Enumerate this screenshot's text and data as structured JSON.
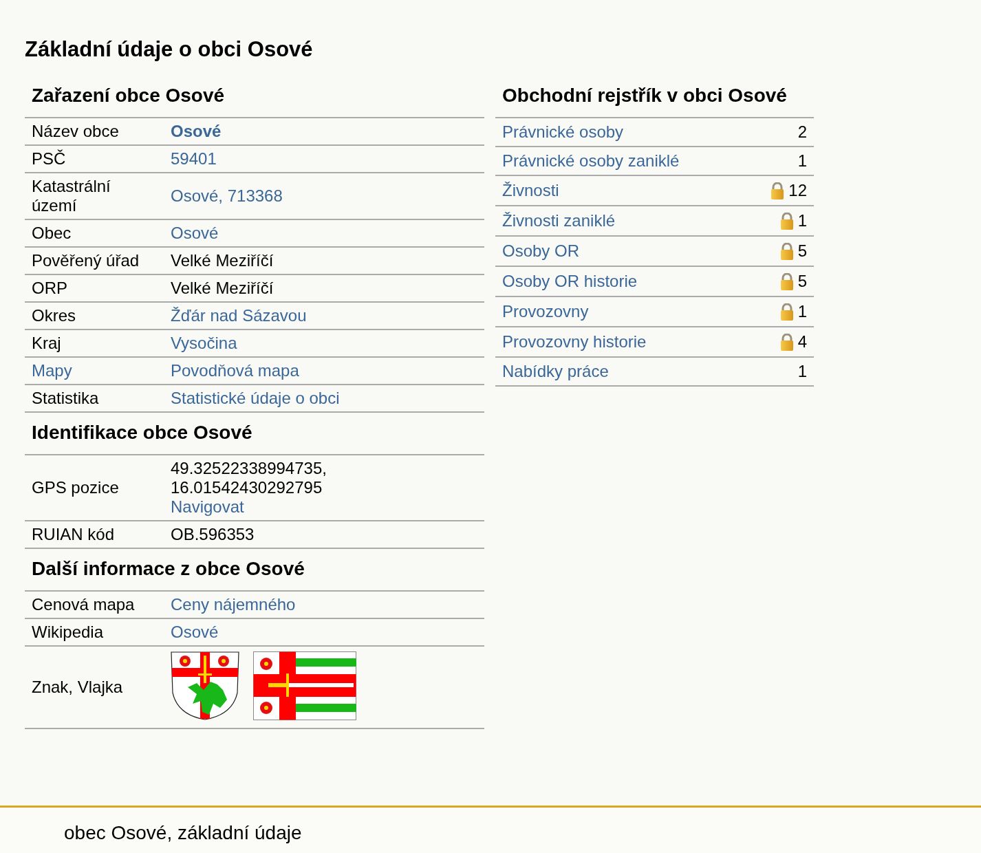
{
  "page_title": "Základní údaje o obci Osové",
  "sections": [
    {
      "title": "Zařazení obce Osové",
      "rows": [
        {
          "label": {
            "text": "Název obce",
            "kind": "text"
          },
          "value": [
            {
              "text": "Osové",
              "kind": "strong_link"
            }
          ]
        },
        {
          "label": {
            "text": "PSČ",
            "kind": "text"
          },
          "value": [
            {
              "text": "59401",
              "kind": "link"
            }
          ]
        },
        {
          "label": {
            "text": "Katastrální území",
            "kind": "text"
          },
          "value": [
            {
              "text": "Osové, 713368",
              "kind": "link"
            }
          ]
        },
        {
          "label": {
            "text": "Obec",
            "kind": "text"
          },
          "value": [
            {
              "text": "Osové",
              "kind": "link"
            }
          ]
        },
        {
          "label": {
            "text": "Pověřený úřad",
            "kind": "text"
          },
          "value": [
            {
              "text": "Velké Meziříčí",
              "kind": "text"
            }
          ]
        },
        {
          "label": {
            "text": "ORP",
            "kind": "text"
          },
          "value": [
            {
              "text": "Velké Meziříčí",
              "kind": "text"
            }
          ]
        },
        {
          "label": {
            "text": "Okres",
            "kind": "text"
          },
          "value": [
            {
              "text": "Žďár nad Sázavou",
              "kind": "link"
            }
          ]
        },
        {
          "label": {
            "text": "Kraj",
            "kind": "text"
          },
          "value": [
            {
              "text": "Vysočina",
              "kind": "link"
            }
          ]
        },
        {
          "label": {
            "text": "Mapy",
            "kind": "link"
          },
          "value": [
            {
              "text": "Povodňová mapa",
              "kind": "link"
            }
          ]
        },
        {
          "label": {
            "text": "Statistika",
            "kind": "text"
          },
          "value": [
            {
              "text": "Statistické údaje o obci",
              "kind": "link"
            }
          ]
        }
      ]
    },
    {
      "title": "Identifikace obce Osové",
      "rows": [
        {
          "label": {
            "text": "GPS pozice",
            "kind": "text"
          },
          "value": [
            {
              "text": "49.32522338994735,",
              "kind": "text"
            },
            {
              "text": "16.01542430292795",
              "kind": "text"
            },
            {
              "text": "Navigovat",
              "kind": "link"
            }
          ]
        },
        {
          "label": {
            "text": "RUIAN kód",
            "kind": "text"
          },
          "value": [
            {
              "text": "OB.596353",
              "kind": "text"
            }
          ]
        }
      ]
    },
    {
      "title": "Další informace z obce Osové",
      "rows": [
        {
          "label": {
            "text": "Cenová mapa",
            "kind": "text"
          },
          "value": [
            {
              "text": "Ceny nájemného",
              "kind": "link"
            }
          ]
        },
        {
          "label": {
            "text": "Wikipedia",
            "kind": "text"
          },
          "value": [
            {
              "text": "Osové",
              "kind": "link"
            }
          ]
        },
        {
          "label": {
            "text": "Znak, Vlajka",
            "kind": "text"
          },
          "value": [
            {
              "kind": "coat_of_arms"
            },
            {
              "kind": "flag"
            }
          ]
        }
      ]
    }
  ],
  "register": {
    "title": "Obchodní rejstřík v obci Osové",
    "rows": [
      {
        "label": "Právnické osoby",
        "locked": false,
        "count": "2"
      },
      {
        "label": "Právnické osoby zaniklé",
        "locked": false,
        "count": "1"
      },
      {
        "label": "Živnosti",
        "locked": true,
        "count": "12"
      },
      {
        "label": "Živnosti zaniklé",
        "locked": true,
        "count": "1"
      },
      {
        "label": "Osoby OR",
        "locked": true,
        "count": "5"
      },
      {
        "label": "Osoby OR historie",
        "locked": true,
        "count": "5"
      },
      {
        "label": "Provozovny",
        "locked": true,
        "count": "1"
      },
      {
        "label": "Provozovny historie",
        "locked": true,
        "count": "4"
      },
      {
        "label": "Nabídky práce",
        "locked": false,
        "count": "1"
      }
    ]
  },
  "footer": {
    "text": "obec Osové, základní údaje"
  }
}
